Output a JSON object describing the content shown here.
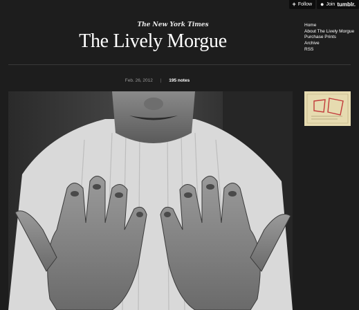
{
  "tumblr": {
    "follow_icon": "plus-icon",
    "follow_label": "Follow",
    "join_icon": "user-icon",
    "join_label": "Join",
    "brand": "tumblr."
  },
  "header": {
    "masthead": "The New York Times",
    "title": "The Lively Morgue"
  },
  "nav": {
    "items": [
      "Home",
      "About The Lively Morgue",
      "Purchase Prints",
      "Archive",
      "RSS"
    ]
  },
  "post": {
    "date": "Feb. 26, 2012",
    "separator": "|",
    "notes": "195 notes"
  },
  "colors": {
    "background": "#1d1d1d",
    "text": "#ffffff",
    "meta": "#9a9a9a"
  }
}
